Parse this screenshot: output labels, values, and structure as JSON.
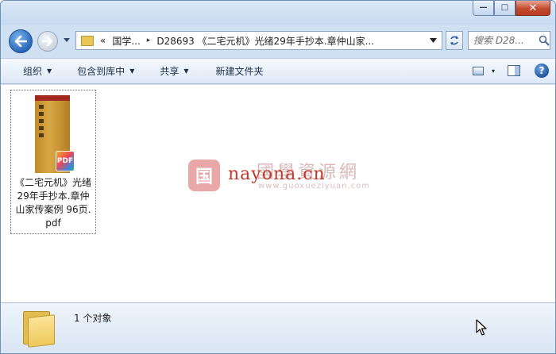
{
  "window": {
    "caption_buttons": {
      "minimize": "—",
      "maximize": "□",
      "close": "✕"
    }
  },
  "nav": {
    "breadcrumb": {
      "chevrons": "«",
      "parent": "国学...",
      "separator": "▸",
      "current": "D28693 《二宅元机》光绪29年手抄本.章仲山家..."
    },
    "search_placeholder": "搜索 D28...",
    "dropdown_glyph": "▾"
  },
  "commands": [
    {
      "label": "组织",
      "has_arrow": true
    },
    {
      "label": "包含到库中",
      "has_arrow": true
    },
    {
      "label": "共享",
      "has_arrow": true
    },
    {
      "label": "新建文件夹",
      "has_arrow": false
    }
  ],
  "command_right": {
    "view_arrow": "▾",
    "help": "?"
  },
  "files": [
    {
      "name_lines": [
        "《二宅元机》光绪",
        "29年手抄本.章仲",
        "山家传案例 96页.",
        "pdf"
      ],
      "badge": "PDF"
    }
  ],
  "watermark": {
    "site": "nayona.cn",
    "cn": "國學資源網",
    "sub": "www.guoxueziyuan.com"
  },
  "details": {
    "count_text": "1 个对象"
  },
  "colors": {
    "titlebar": "#cfe0f3",
    "close_button": "#c44a2e",
    "folder": "#efc85a",
    "watermark_red": "#c0392b"
  }
}
